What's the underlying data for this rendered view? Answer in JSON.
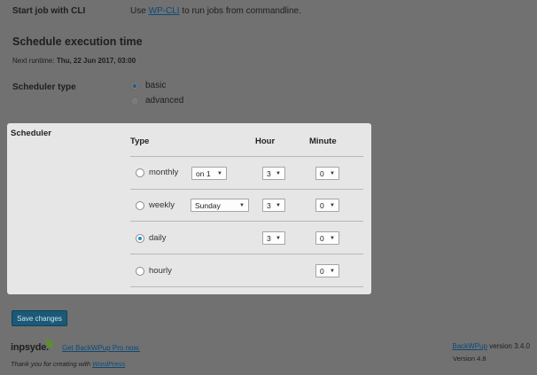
{
  "cli": {
    "label": "Start job with CLI",
    "prefix": "Use",
    "link": "WP-CLI",
    "suffix": "to run jobs from commandline."
  },
  "schedule": {
    "title": "Schedule execution time",
    "next_runtime_label": "Next runtime:",
    "next_runtime_value": "Thu, 22 Jun 2017, 03:00"
  },
  "scheduler_type": {
    "label": "Scheduler type",
    "options": [
      {
        "label": "basic",
        "checked": true
      },
      {
        "label": "advanced",
        "checked": false
      }
    ]
  },
  "scheduler": {
    "label": "Scheduler",
    "headers": {
      "type": "Type",
      "hour": "Hour",
      "minute": "Minute"
    },
    "rows": [
      {
        "type": "monthly",
        "checked": false,
        "day": "on 1",
        "hour": "3",
        "minute": "0"
      },
      {
        "type": "weekly",
        "checked": false,
        "day": "Sunday",
        "hour": "3",
        "minute": "0"
      },
      {
        "type": "daily",
        "checked": true,
        "day": null,
        "hour": "3",
        "minute": "0"
      },
      {
        "type": "hourly",
        "checked": false,
        "day": null,
        "hour": null,
        "minute": "0"
      }
    ]
  },
  "actions": {
    "save_label": "Save changes"
  },
  "footer": {
    "logo_text": "inpsyde.",
    "pro_link": "Get BackWPup Pro now.",
    "thanks_prefix": "Thank you for creating with",
    "thanks_link": "WordPress",
    "plugin_link": "BackWPup",
    "plugin_version": "version 3.4.0",
    "wp_version": "Version 4.8"
  },
  "colors": {
    "overlay_bg": "#717171",
    "panel_bg": "#e6e6e6",
    "primary_button": "#1a5a78",
    "link": "#0b4a78"
  }
}
